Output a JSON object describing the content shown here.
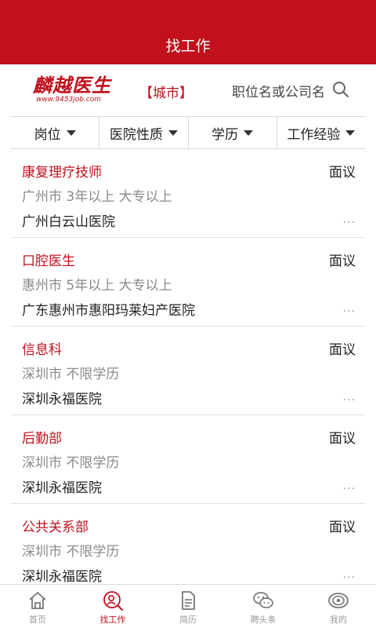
{
  "header": {
    "title": "找工作"
  },
  "search": {
    "logo_main": "麟越医生",
    "logo_sub": "www.9453job.com",
    "city": "【城市】",
    "placeholder": "职位名或公司名"
  },
  "filters": [
    "岗位",
    "医院性质",
    "学历",
    "工作经验"
  ],
  "jobs": [
    {
      "title": "康复理疗技师",
      "salary": "面议",
      "meta": "广州市 3年以上 大专以上",
      "company": "广州白云山医院"
    },
    {
      "title": "口腔医生",
      "salary": "面议",
      "meta": "惠州市 5年以上 大专以上",
      "company": "广东惠州市惠阳玛莱妇产医院"
    },
    {
      "title": "信息科",
      "salary": "面议",
      "meta": "深圳市 不限学历",
      "company": "深圳永福医院"
    },
    {
      "title": "后勤部",
      "salary": "面议",
      "meta": "深圳市 不限学历",
      "company": "深圳永福医院"
    },
    {
      "title": "公共关系部",
      "salary": "面议",
      "meta": "深圳市 不限学历",
      "company": "深圳永福医院"
    }
  ],
  "more_label": "...",
  "tabs": [
    {
      "label": "首页",
      "icon": "home-icon",
      "active": false
    },
    {
      "label": "找工作",
      "icon": "search-job-icon",
      "active": true
    },
    {
      "label": "简历",
      "icon": "resume-icon",
      "active": false
    },
    {
      "label": "聘头条",
      "icon": "chat-icon",
      "active": false
    },
    {
      "label": "我的",
      "icon": "eye-icon",
      "active": false
    }
  ],
  "colors": {
    "brand": "#c0111d",
    "muted": "#8a8a8a"
  }
}
